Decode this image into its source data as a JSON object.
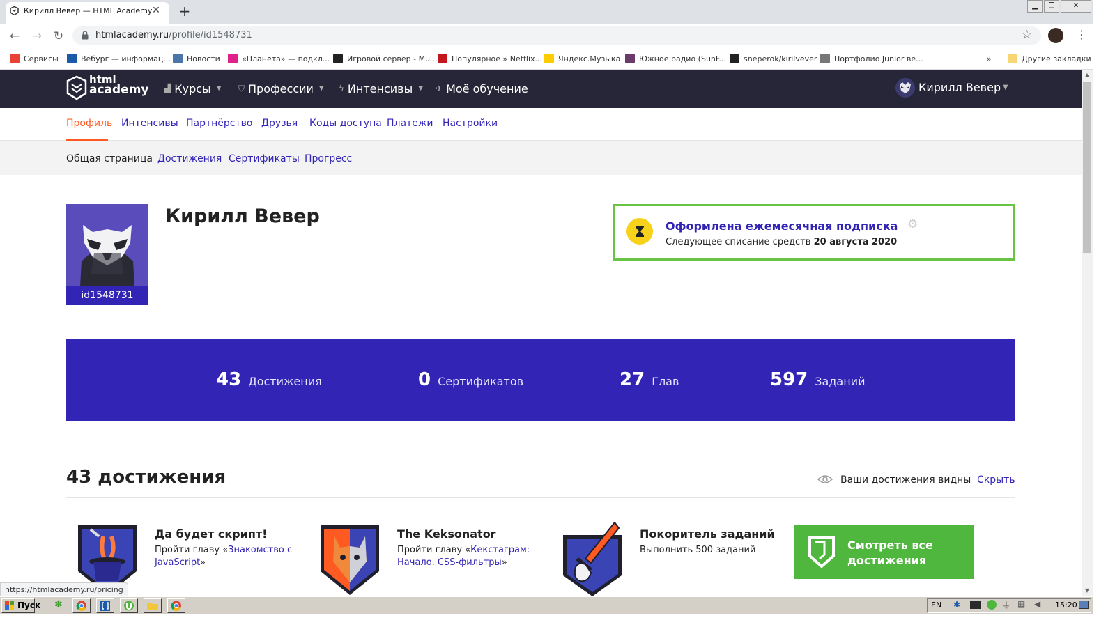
{
  "browser": {
    "tab_title": "Кирилл Вевер — HTML Academy",
    "tab_close": "✕",
    "new_tab": "+",
    "url_host": "htmlacademy.ru",
    "url_path": "/profile/id1548731",
    "bookmarks": [
      {
        "label": "Сервисы",
        "icon": "apps-grid-icon",
        "color": "#ea4335"
      },
      {
        "label": "Вебург — информац...",
        "icon": "weburg-icon",
        "color": "#1a5aa8"
      },
      {
        "label": "Новости",
        "icon": "vk-icon",
        "color": "#4a76a8"
      },
      {
        "label": "«Планета» — подкл...",
        "icon": "planeta-icon",
        "color": "#e0218a"
      },
      {
        "label": "Игровой сервер - Mu...",
        "icon": "mu-icon",
        "color": "#222222"
      },
      {
        "label": "Популярное » Netflix...",
        "icon": "netflix-icon",
        "color": "#c4161c"
      },
      {
        "label": "Яндекс.Музыка",
        "icon": "yandex-music-icon",
        "color": "#ffcc00"
      },
      {
        "label": "Южное радио (SunF...",
        "icon": "radio-icon",
        "color": "#6b3b6b"
      },
      {
        "label": "sneperok/kirilvever",
        "icon": "github-icon",
        "color": "#222222"
      },
      {
        "label": "Портфолио Junior ве...",
        "icon": "globe-icon",
        "color": "#777777"
      }
    ],
    "bookmarks_more": "»",
    "other_bookmarks": "Другие закладки",
    "status_url": "https://htmlacademy.ru/pricing"
  },
  "header": {
    "logo_line1": "html",
    "logo_line2": "academy",
    "nav": [
      {
        "label": "Курсы",
        "icon": "bar-chart-icon",
        "dropdown": true
      },
      {
        "label": "Профессии",
        "icon": "shield-icon",
        "dropdown": true
      },
      {
        "label": "Интенсивы",
        "icon": "lightning-icon",
        "dropdown": true
      },
      {
        "label": "Моё обучение",
        "icon": "rocket-icon",
        "dropdown": false
      }
    ],
    "user_name": "Кирилл Вевер"
  },
  "profile_tabs": [
    "Профиль",
    "Интенсивы",
    "Партнёрство",
    "Друзья",
    "Коды доступа",
    "Платежи",
    "Настройки"
  ],
  "profile_tabs_active": "Профиль",
  "subtabs": [
    "Общая страница",
    "Достижения",
    "Сертификаты",
    "Прогресс"
  ],
  "subtabs_active": "Общая страница",
  "profile": {
    "name": "Кирилл Вевер",
    "id": "id1548731"
  },
  "subscription": {
    "title": "Оформлена ежемесячная подписка",
    "text": "Следующее списание средств",
    "date": "20 августа 2020"
  },
  "stats": [
    {
      "value": "43",
      "label": "Достижения"
    },
    {
      "value": "0",
      "label": "Сертификатов"
    },
    {
      "value": "27",
      "label": "Глав"
    },
    {
      "value": "597",
      "label": "Заданий"
    }
  ],
  "achievements": {
    "title": "43 достижения",
    "visibility_text": "Ваши достижения видны",
    "hide_link": "Скрыть",
    "items": [
      {
        "name": "Да будет скрипт!",
        "desc_prefix": "Пройти главу «",
        "link": "Знакомство с JavaScript",
        "desc_suffix": "»"
      },
      {
        "name": "The Keksonator",
        "desc_prefix": "Пройти главу «",
        "link": "Кекстаграм: Начало. CSS-фильтры",
        "desc_suffix": "»"
      },
      {
        "name": "Покоритель заданий",
        "desc_prefix": "Выполнить 500 заданий",
        "link": "",
        "desc_suffix": ""
      }
    ],
    "see_all": "Смотреть все достижения"
  },
  "taskbar": {
    "start": "Пуск",
    "lang": "EN",
    "time": "15:20"
  },
  "colors": {
    "brand_purple": "#3224b4",
    "accent_orange": "#ff5a22",
    "header_dark": "#272638",
    "success_green": "#4fb63e"
  }
}
